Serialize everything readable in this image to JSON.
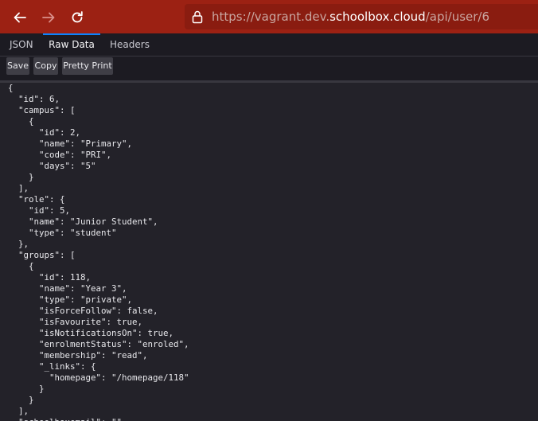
{
  "browser": {
    "url_prefix": "https://vagrant.dev.",
    "url_domain": "schoolbox.cloud",
    "url_path": "/api/user/6"
  },
  "viewer": {
    "tabs": [
      "JSON",
      "Raw Data",
      "Headers"
    ],
    "selected_tab": "Raw Data",
    "actions": {
      "save": "Save",
      "copy": "Copy",
      "pretty_print": "Pretty Print"
    },
    "raw_text": "{\n  \"id\": 6,\n  \"campus\": [\n    {\n      \"id\": 2,\n      \"name\": \"Primary\",\n      \"code\": \"PRI\",\n      \"days\": \"5\"\n    }\n  ],\n  \"role\": {\n    \"id\": 5,\n    \"name\": \"Junior Student\",\n    \"type\": \"student\"\n  },\n  \"groups\": [\n    {\n      \"id\": 118,\n      \"name\": \"Year 3\",\n      \"type\": \"private\",\n      \"isForceFollow\": false,\n      \"isFavourite\": true,\n      \"isNotificationsOn\": true,\n      \"enrolmentStatus\": \"enroled\",\n      \"membership\": \"read\",\n      \"_links\": {\n        \"homepage\": \"/homepage/118\"\n      }\n    }\n  ],\n  \"schoolboxemail\": \"\""
  },
  "icons": [
    "back-arrow-icon",
    "forward-arrow-icon",
    "reload-icon",
    "lock-icon"
  ],
  "colors": {
    "toolbar_bg": "#9c2113",
    "urlbar_bg": "#8a1c10",
    "tab_accent": "#0a84ff",
    "page_bg": "#1c1b22",
    "content_bg": "#232229"
  }
}
